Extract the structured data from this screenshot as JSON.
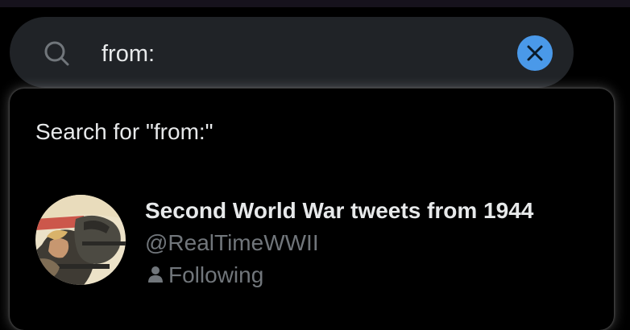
{
  "search": {
    "value": "from:",
    "clear_label": "Clear search"
  },
  "dropdown": {
    "search_for_text": "Search for \"from:\"",
    "results": [
      {
        "name": "Second World War tweets from 1944",
        "handle": "@RealTimeWWII",
        "status": "Following",
        "status_icon": "person-icon",
        "avatar": "avatar-image"
      }
    ]
  },
  "colors": {
    "background": "#000000",
    "search_bar": "#202327",
    "accent": "#4a99e9",
    "primary_text": "#e7e9ea",
    "secondary_text": "#71767b"
  }
}
